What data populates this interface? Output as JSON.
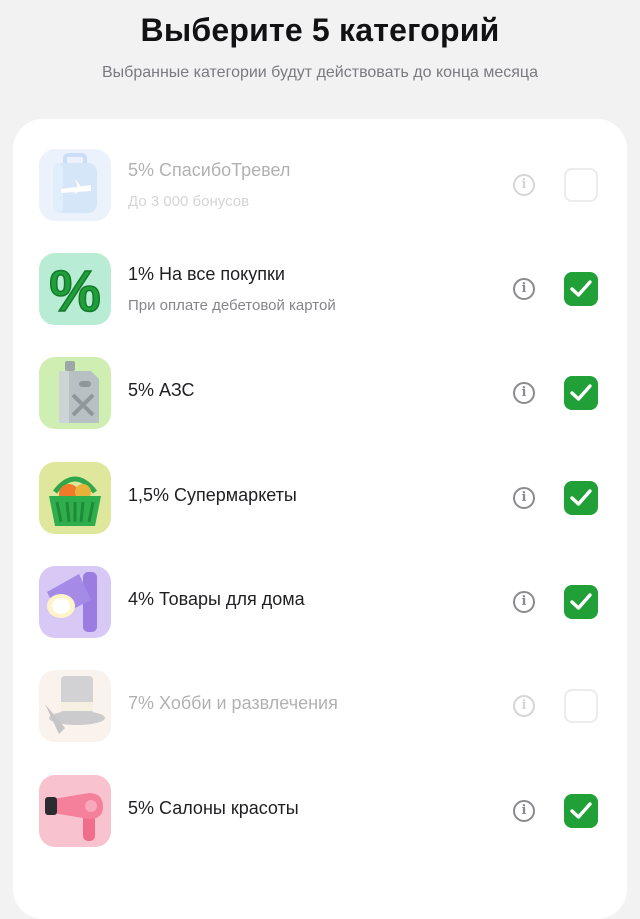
{
  "header": {
    "title": "Выберите 5 категорий",
    "subtitle": "Выбранные категории будут действовать до конца месяца"
  },
  "categories": [
    {
      "id": "travel",
      "name": "5% СпасибоТревел",
      "note": "До 3 000 бонусов",
      "checked": false,
      "disabled": true,
      "icon": "suitcase-icon"
    },
    {
      "id": "all",
      "name": "1% На все покупки",
      "note": "При оплате дебетовой картой",
      "checked": true,
      "disabled": false,
      "icon": "percent-icon"
    },
    {
      "id": "fuel",
      "name": "5% АЗС",
      "checked": true,
      "disabled": false,
      "icon": "jerrycan-icon"
    },
    {
      "id": "grocery",
      "name": "1,5% Супермаркеты",
      "checked": true,
      "disabled": false,
      "icon": "basket-icon"
    },
    {
      "id": "home",
      "name": "4% Товары для дома",
      "checked": true,
      "disabled": false,
      "icon": "lamp-icon"
    },
    {
      "id": "hobby",
      "name": "7% Хобби и развлечения",
      "checked": false,
      "disabled": true,
      "icon": "top-hat-icon"
    },
    {
      "id": "beauty",
      "name": "5% Салоны красоты",
      "checked": true,
      "disabled": false,
      "icon": "hair-dryer-icon"
    }
  ],
  "info_glyph": "i",
  "colors": {
    "background": "#f2f2f2",
    "card": "#ffffff",
    "checkbox_checked": "#21a038",
    "checkbox_unchecked_border": "#c9c9ce"
  }
}
